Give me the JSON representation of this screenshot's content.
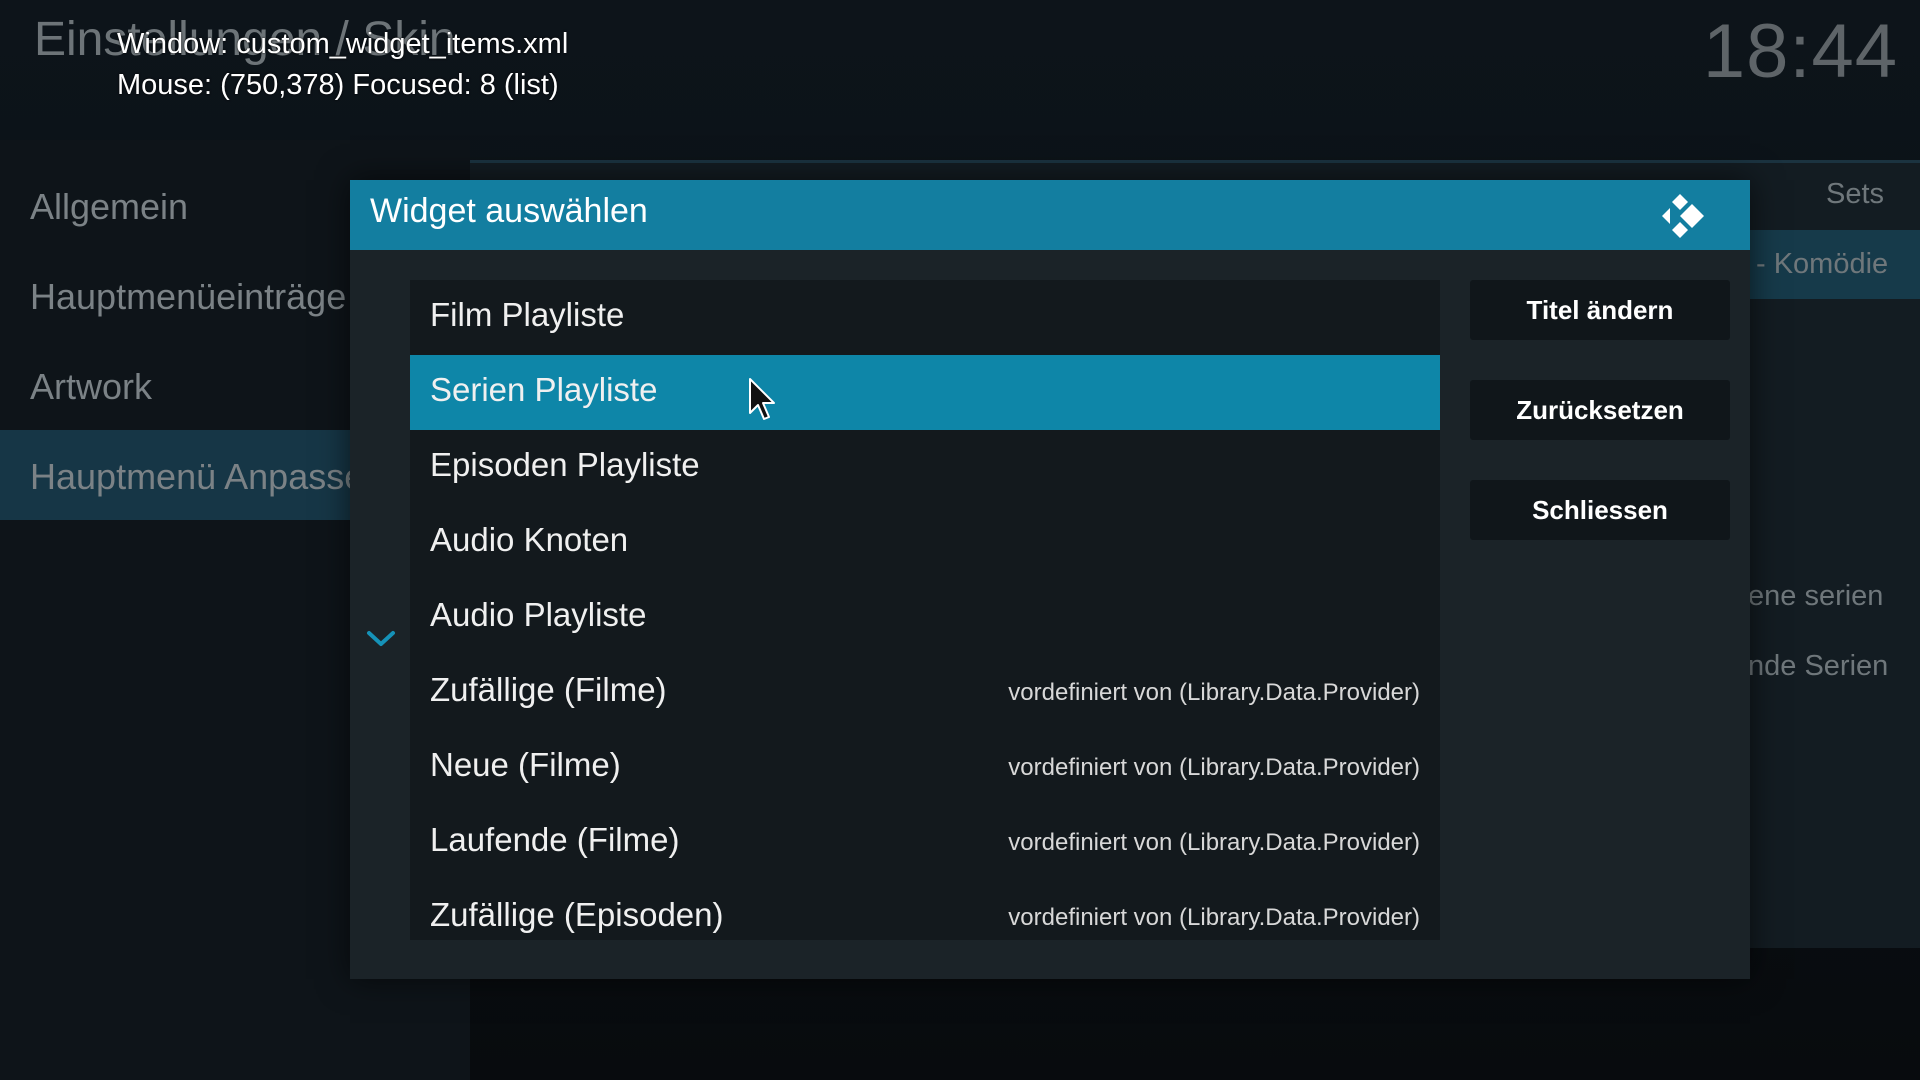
{
  "debug": {
    "window_line": "Window: custom_widget_items.xml",
    "mouse_line": "Mouse: (750,378)  Focused: 8 (list)"
  },
  "background": {
    "title": "Einstellungen / Skin",
    "clock": "18:44",
    "left_menu": [
      "Allgemein",
      "Hauptmenüeinträge",
      "Artwork",
      "Hauptmenü Anpassen"
    ],
    "right_header": "Sets",
    "right_selected": "- Komödie",
    "right_items": [
      "ene serien",
      "nde Serien"
    ]
  },
  "dialog": {
    "title": "Widget auswählen",
    "logo_icon": "kodi-logo-icon",
    "scroll_icon": "chevron-down-icon",
    "items": [
      {
        "label": "Film Playliste",
        "sub": ""
      },
      {
        "label": "Serien Playliste",
        "sub": "",
        "selected": true
      },
      {
        "label": "Episoden Playliste",
        "sub": ""
      },
      {
        "label": "Audio Knoten",
        "sub": ""
      },
      {
        "label": "Audio Playliste",
        "sub": ""
      },
      {
        "label": "Zufällige (Filme)",
        "sub": "vordefiniert von (Library.Data.Provider)"
      },
      {
        "label": "Neue (Filme)",
        "sub": "vordefiniert von (Library.Data.Provider)"
      },
      {
        "label": "Laufende (Filme)",
        "sub": "vordefiniert von (Library.Data.Provider)"
      },
      {
        "label": "Zufällige (Episoden)",
        "sub": "vordefiniert von (Library.Data.Provider)"
      }
    ],
    "buttons": {
      "rename": "Titel ändern",
      "reset": "Zurücksetzen",
      "close": "Schliessen"
    },
    "colors": {
      "header": "#137ea0",
      "selected": "#0e86a8",
      "scroll_arrow": "#1592b8"
    }
  }
}
